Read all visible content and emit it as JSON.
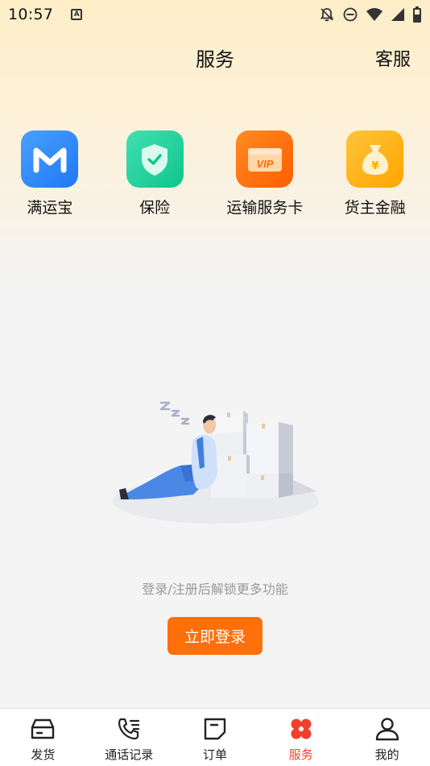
{
  "status_bar": {
    "time": "10:57",
    "notification_icon": "A",
    "icons": [
      "bell-off-icon",
      "dnd-icon",
      "wifi-icon",
      "cellular-icon",
      "battery-icon"
    ]
  },
  "header": {
    "title": "服务",
    "customer_service": "客服"
  },
  "services": [
    {
      "label": "满运宝",
      "icon": "m-logo-icon",
      "color": "#2f8cff"
    },
    {
      "label": "保险",
      "icon": "shield-check-icon",
      "color": "#1fcf9a"
    },
    {
      "label": "运输服务卡",
      "icon": "vip-card-icon",
      "color": "#ff6a08"
    },
    {
      "label": "货主金融",
      "icon": "money-bag-icon",
      "color": "#ffb11a"
    }
  ],
  "empty_state": {
    "message": "登录/注册后解锁更多功能",
    "button": "立即登录"
  },
  "bottom_nav": {
    "active": "服务",
    "accent_color": "#f0402a",
    "items": [
      {
        "label": "发货",
        "icon": "box-icon"
      },
      {
        "label": "通话记录",
        "icon": "phone-list-icon"
      },
      {
        "label": "订单",
        "icon": "order-icon"
      },
      {
        "label": "服务",
        "icon": "services-icon"
      },
      {
        "label": "我的",
        "icon": "user-icon"
      }
    ]
  }
}
